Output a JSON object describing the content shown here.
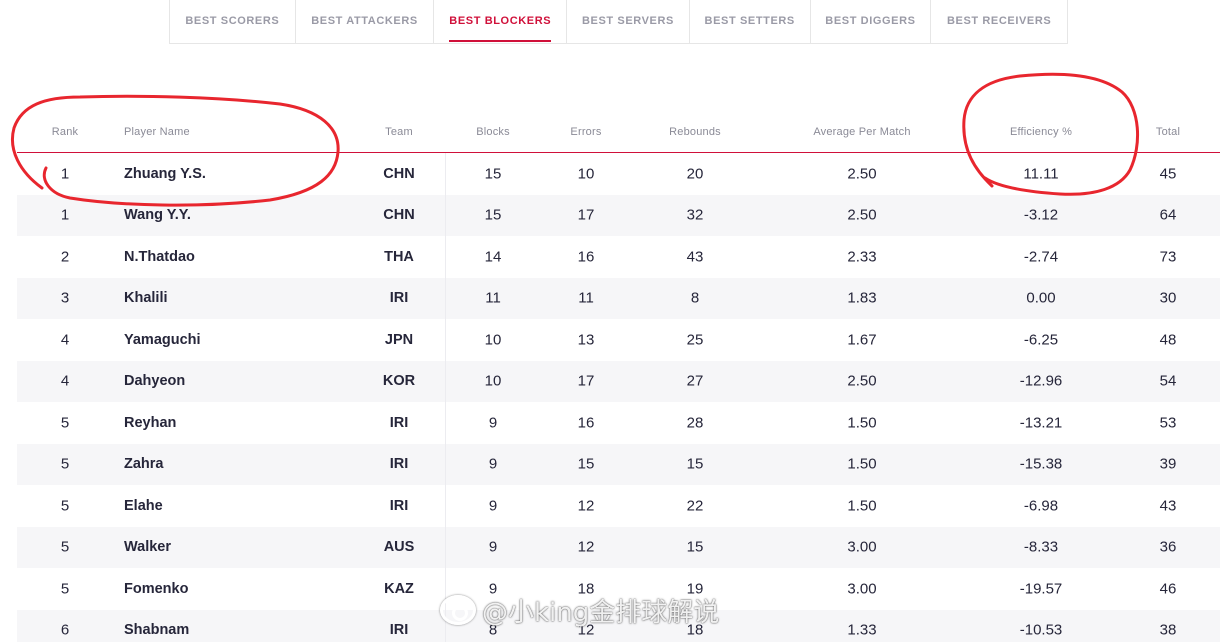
{
  "tabs": [
    {
      "label": "BEST SCORERS",
      "active": false
    },
    {
      "label": "BEST ATTACKERS",
      "active": false
    },
    {
      "label": "BEST BLOCKERS",
      "active": true
    },
    {
      "label": "BEST SERVERS",
      "active": false
    },
    {
      "label": "BEST SETTERS",
      "active": false
    },
    {
      "label": "BEST DIGGERS",
      "active": false
    },
    {
      "label": "BEST RECEIVERS",
      "active": false
    }
  ],
  "table": {
    "headers": {
      "rank": "Rank",
      "player_name": "Player Name",
      "team": "Team",
      "blocks": "Blocks",
      "errors": "Errors",
      "rebounds": "Rebounds",
      "average": "Average Per Match",
      "efficiency": "Efficiency %",
      "total": "Total"
    },
    "rows": [
      {
        "rank": "1",
        "name": "Zhuang Y.S.",
        "team": "CHN",
        "blocks": "15",
        "errors": "10",
        "rebounds": "20",
        "avg": "2.50",
        "eff": "11.11",
        "total": "45"
      },
      {
        "rank": "1",
        "name": "Wang Y.Y.",
        "team": "CHN",
        "blocks": "15",
        "errors": "17",
        "rebounds": "32",
        "avg": "2.50",
        "eff": "-3.12",
        "total": "64"
      },
      {
        "rank": "2",
        "name": "N.Thatdao",
        "team": "THA",
        "blocks": "14",
        "errors": "16",
        "rebounds": "43",
        "avg": "2.33",
        "eff": "-2.74",
        "total": "73"
      },
      {
        "rank": "3",
        "name": "Khalili",
        "team": "IRI",
        "blocks": "11",
        "errors": "11",
        "rebounds": "8",
        "avg": "1.83",
        "eff": "0.00",
        "total": "30"
      },
      {
        "rank": "4",
        "name": "Yamaguchi",
        "team": "JPN",
        "blocks": "10",
        "errors": "13",
        "rebounds": "25",
        "avg": "1.67",
        "eff": "-6.25",
        "total": "48"
      },
      {
        "rank": "4",
        "name": "Dahyeon",
        "team": "KOR",
        "blocks": "10",
        "errors": "17",
        "rebounds": "27",
        "avg": "2.50",
        "eff": "-12.96",
        "total": "54"
      },
      {
        "rank": "5",
        "name": "Reyhan",
        "team": "IRI",
        "blocks": "9",
        "errors": "16",
        "rebounds": "28",
        "avg": "1.50",
        "eff": "-13.21",
        "total": "53"
      },
      {
        "rank": "5",
        "name": "Zahra",
        "team": "IRI",
        "blocks": "9",
        "errors": "15",
        "rebounds": "15",
        "avg": "1.50",
        "eff": "-15.38",
        "total": "39"
      },
      {
        "rank": "5",
        "name": "Elahe",
        "team": "IRI",
        "blocks": "9",
        "errors": "12",
        "rebounds": "22",
        "avg": "1.50",
        "eff": "-6.98",
        "total": "43"
      },
      {
        "rank": "5",
        "name": "Walker",
        "team": "AUS",
        "blocks": "9",
        "errors": "12",
        "rebounds": "15",
        "avg": "3.00",
        "eff": "-8.33",
        "total": "36"
      },
      {
        "rank": "5",
        "name": "Fomenko",
        "team": "KAZ",
        "blocks": "9",
        "errors": "18",
        "rebounds": "19",
        "avg": "3.00",
        "eff": "-19.57",
        "total": "46"
      },
      {
        "rank": "6",
        "name": "Shabnam",
        "team": "IRI",
        "blocks": "8",
        "errors": "12",
        "rebounds": "18",
        "avg": "1.33",
        "eff": "-10.53",
        "total": "38"
      }
    ]
  },
  "watermark": {
    "text": "@小king金排球解说"
  },
  "colors": {
    "accent": "#d0103a",
    "annotation": "#e8262e",
    "row_alt": "#f6f6f8"
  }
}
